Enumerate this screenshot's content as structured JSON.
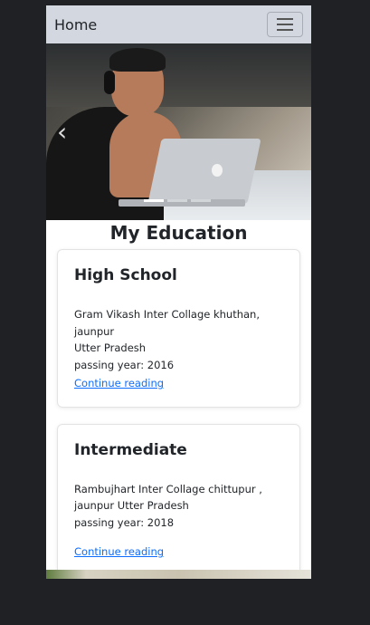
{
  "navbar": {
    "brand": "Home"
  },
  "section": {
    "title": "My Education"
  },
  "cards": [
    {
      "title": "High School",
      "lines": [
        "Gram Vikash Inter Collage khuthan, jaunpur",
        "Utter Pradesh",
        "passing year: 2016"
      ],
      "link": "Continue reading"
    },
    {
      "title": "Intermediate",
      "lines": [
        "Rambujhart Inter Collage chittupur ,",
        "jaunpur Utter Pradesh",
        "passing year: 2018"
      ],
      "link": "Continue reading"
    }
  ],
  "icons": {
    "toggler": "hamburger-menu-icon",
    "prev": "chevron-left-icon"
  },
  "colors": {
    "navbar_bg": "#d3d7df",
    "link": "#0d6efd",
    "page_bg": "#202124"
  }
}
